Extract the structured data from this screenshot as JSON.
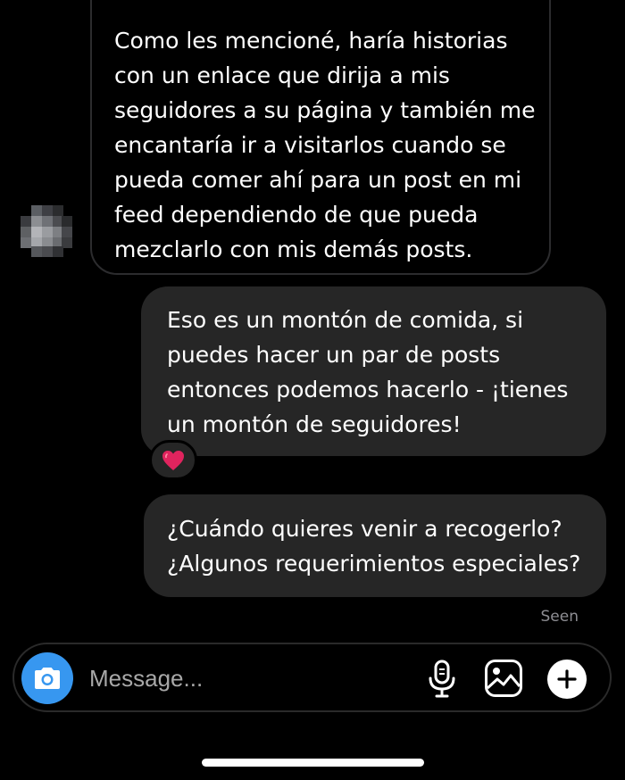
{
  "thread": {
    "incoming_message": {
      "text": "Como les mencioné, haría historias\ncon un enlace que dirija a mis\nseguidores a su página y también me\nencantaría ir a visitarlos cuando se\npueda comer ahí para un post en mi\nfeed dependiendo de que pueda\nmezclarlo con mis demás posts."
    },
    "outgoing_messages": [
      {
        "text": "Eso es un montón de comida, si\npuedes hacer un par de posts\nentonces podemos hacerlo - ¡tienes\nun montón de seguidores!",
        "reaction": "❤️"
      },
      {
        "text": "¿Cuándo quieres venir a recogerlo?\n¿Algunos requerimientos especiales?"
      }
    ],
    "seen_label": "Seen"
  },
  "composer": {
    "placeholder": "Message...",
    "camera_icon": "camera-icon",
    "mic_icon": "microphone-icon",
    "gallery_icon": "gallery-icon",
    "plus_icon": "plus-icon",
    "accent_color": "#3797f0"
  },
  "colors": {
    "background": "#000000",
    "outgoing_bubble": "#262626",
    "incoming_bubble_border": "#2c2c2e"
  }
}
